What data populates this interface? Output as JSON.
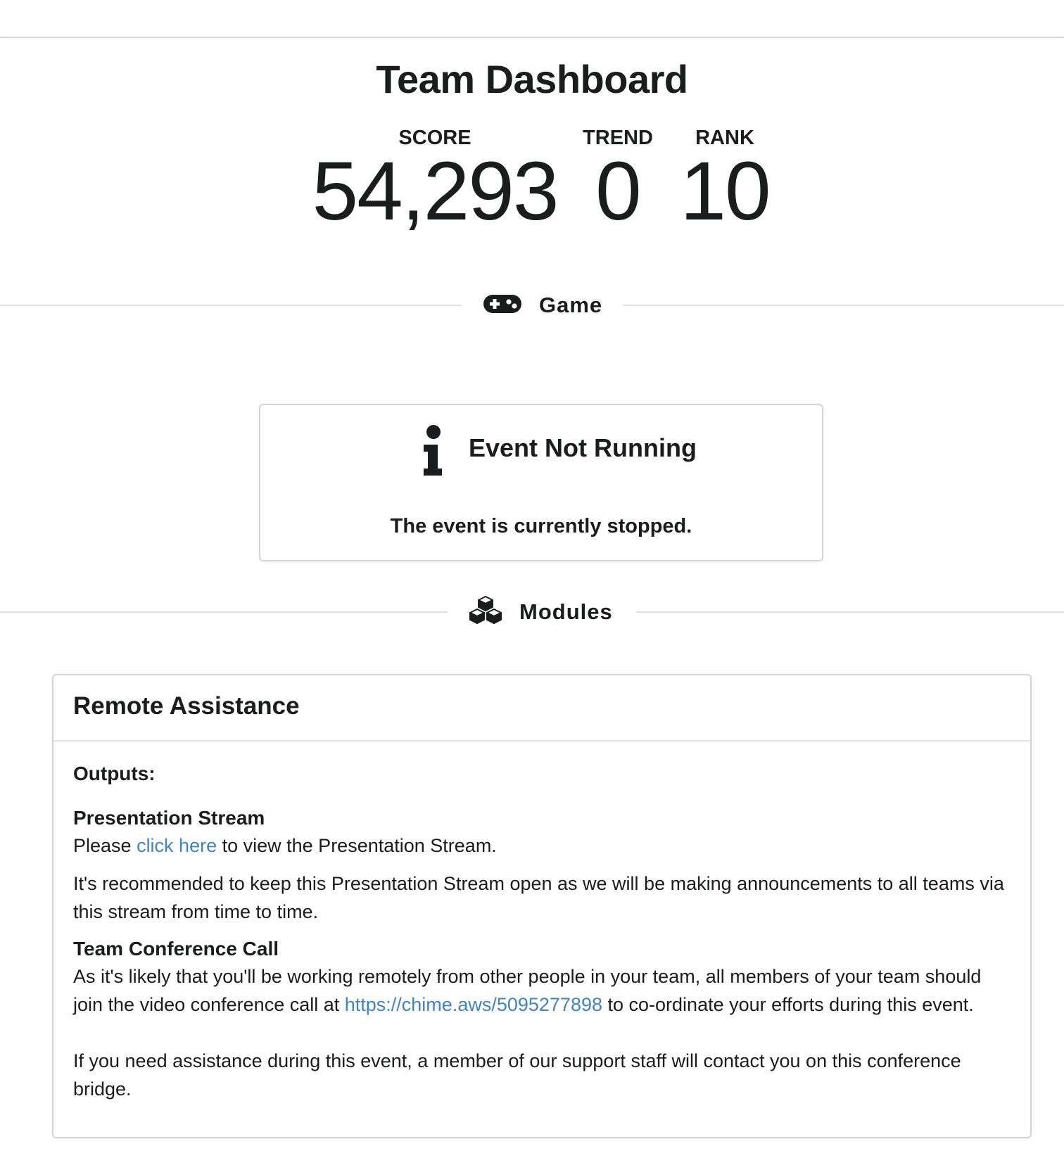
{
  "header": {
    "title": "Team Dashboard"
  },
  "stats": {
    "score": {
      "label": "SCORE",
      "value": "54,293"
    },
    "trend": {
      "label": "TREND",
      "value": "0"
    },
    "rank": {
      "label": "RANK",
      "value": "10"
    }
  },
  "sections": {
    "game": {
      "label": "Game",
      "icon": "gamepad-icon"
    },
    "modules": {
      "label": "Modules",
      "icon": "cubes-icon"
    }
  },
  "event_status": {
    "icon": "info-icon",
    "title": "Event Not Running",
    "message": "The event is currently stopped."
  },
  "remote_assistance": {
    "title": "Remote Assistance",
    "outputs_label": "Outputs:",
    "presentation_stream": {
      "heading": "Presentation Stream",
      "text_before": "Please ",
      "link_text": "click here",
      "text_after": " to view the Presentation Stream.",
      "recommendation": "It's recommended to keep this Presentation Stream open as we will be making announcements to all teams via this stream from time to time."
    },
    "conference_call": {
      "heading": "Team Conference Call",
      "text_before": "As it's likely that you'll be working remotely from other people in your team, all members of your team should join the video conference call at ",
      "link_text": "https://chime.aws/5095277898",
      "text_after": " to co-ordinate your efforts during this event.",
      "assistance": "If you need assistance during this event, a member of our support staff will contact you on this conference bridge."
    }
  },
  "colors": {
    "link": "#4183c4",
    "text": "#1b1c1d",
    "border": "#d4d4d5"
  }
}
